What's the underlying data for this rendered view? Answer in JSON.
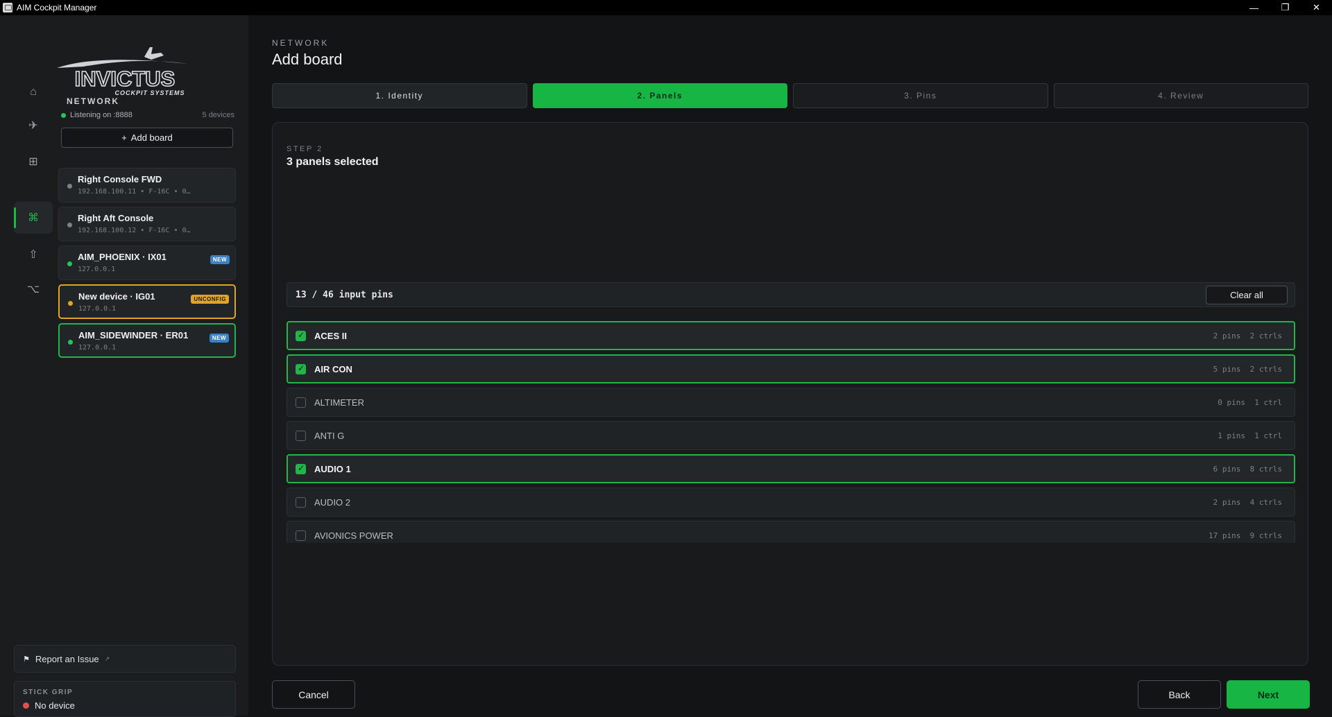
{
  "window": {
    "title": "AIM Cockpit Manager",
    "minimize": "—",
    "restore": "❐",
    "close": "✕"
  },
  "rail": [
    {
      "icon": "home-icon",
      "glyph": "⌂"
    },
    {
      "icon": "plane-icon",
      "glyph": "✈"
    },
    {
      "icon": "grid-icon",
      "glyph": "⊞"
    },
    {
      "icon": "network-icon",
      "glyph": "⌘",
      "active": true
    },
    {
      "icon": "upload-icon",
      "glyph": "⇧"
    },
    {
      "icon": "branch-icon",
      "glyph": "⌥"
    }
  ],
  "logo": {
    "brand": "INVICTUS",
    "tagline": "COCKPIT SYSTEMS"
  },
  "network": {
    "heading": "NETWORK",
    "listening": "Listening on :8888",
    "device_count": "5 devices",
    "add_board": "Add board",
    "add_board_glyph": "+"
  },
  "devices": [
    {
      "name": "Right Console FWD",
      "sub": "192.168.100.11  •  F-16C  •  0…",
      "status_color": "#7b8187",
      "badge": "",
      "state": ""
    },
    {
      "name": "Right Aft Console",
      "sub": "192.168.100.12  •  F-16C  •  0…",
      "status_color": "#7b8187",
      "badge": "",
      "state": ""
    },
    {
      "name": "AIM_PHOENIX · IX01",
      "sub": "127.0.0.1",
      "status_color": "#22c55e",
      "badge": "NEW",
      "state": ""
    },
    {
      "name": "New device · IG01",
      "sub": "127.0.0.1",
      "status_color": "#e0a526",
      "badge": "UNCONFIG",
      "state": "warn"
    },
    {
      "name": "AIM_SIDEWINDER · ER01",
      "sub": "127.0.0.1",
      "status_color": "#22c55e",
      "badge": "NEW",
      "state": "ok"
    }
  ],
  "report": {
    "label": "Report an Issue",
    "flag": "⚑",
    "arrow": "↗"
  },
  "stick_grip": {
    "label": "STICK GRIP",
    "value": "No device"
  },
  "main": {
    "crumb": "NETWORK",
    "title": "Add board",
    "steps": [
      {
        "label": "1. Identity",
        "state": "done"
      },
      {
        "label": "2. Panels",
        "state": "active"
      },
      {
        "label": "3. Pins",
        "state": ""
      },
      {
        "label": "4. Review",
        "state": ""
      }
    ],
    "step_label": "STEP 2",
    "step_title": "3 panels selected",
    "pins_summary": "13 / 46 input pins",
    "clear_all": "Clear all",
    "panels": [
      {
        "name": "ACES II",
        "meta": "2 pins  2 ctrls",
        "selected": true
      },
      {
        "name": "AIR CON",
        "meta": "5 pins  2 ctrls",
        "selected": true
      },
      {
        "name": "ALTIMETER",
        "meta": "0 pins  1 ctrl",
        "selected": false
      },
      {
        "name": "ANTI G",
        "meta": "1 pins  1 ctrl",
        "selected": false
      },
      {
        "name": "AUDIO 1",
        "meta": "6 pins  8 ctrls",
        "selected": true
      },
      {
        "name": "AUDIO 2",
        "meta": "2 pins  4 ctrls",
        "selected": false
      },
      {
        "name": "AVIONICS POWER",
        "meta": "17 pins  9 ctrls",
        "selected": false
      }
    ],
    "cancel": "Cancel",
    "back": "Back",
    "next": "Next"
  },
  "colors": {
    "accent": "#16b544",
    "warn": "#e0a526",
    "new_badge": "#3b82c4",
    "error": "#e05252"
  }
}
